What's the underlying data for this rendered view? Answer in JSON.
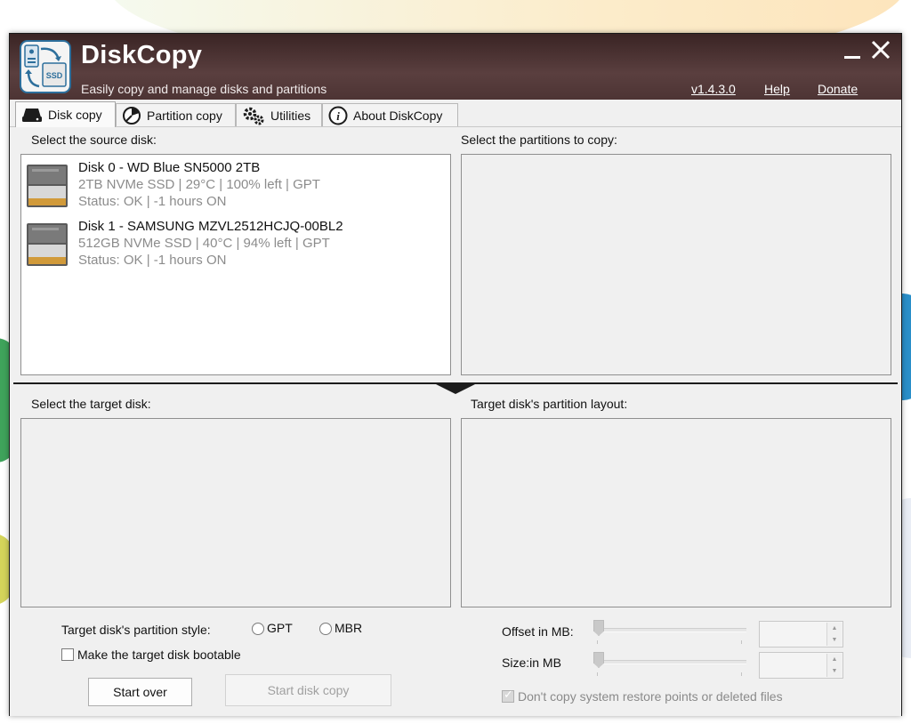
{
  "app": {
    "title": "DiskCopy",
    "subtitle": "Easily copy and manage disks and partitions",
    "version": "v1.4.3.0",
    "help": "Help",
    "donate": "Donate",
    "icon_label": "SSD"
  },
  "tabs": [
    {
      "label": "Disk copy",
      "icon": "disk-icon",
      "active": true
    },
    {
      "label": "Partition copy",
      "icon": "partition-pie-icon"
    },
    {
      "label": "Utilities",
      "icon": "gears-icon"
    },
    {
      "label": "About DiskCopy",
      "icon": "info-icon"
    }
  ],
  "source": {
    "label": "Select the source disk:",
    "disks": [
      {
        "name": "Disk 0 - WD Blue SN5000 2TB",
        "info": "2TB NVMe SSD | 29°C | 100% left | GPT",
        "status": "Status: OK | -1 hours ON"
      },
      {
        "name": "Disk 1 - SAMSUNG MZVL2512HCJQ-00BL2",
        "info": "512GB NVMe SSD | 40°C | 94% left | GPT",
        "status": "Status: OK | -1 hours ON"
      }
    ]
  },
  "partitions": {
    "label": "Select the partitions to copy:"
  },
  "target": {
    "label": "Select the target disk:"
  },
  "layout": {
    "label": "Target disk's partition layout:"
  },
  "options": {
    "style_label": "Target disk's partition style:",
    "gpt": "GPT",
    "mbr": "MBR",
    "bootable": "Make the target disk bootable",
    "start_over": "Start over",
    "start_copy": "Start disk copy",
    "offset_label": "Offset in MB:",
    "size_label": "Size:in MB",
    "no_restore": "Don't copy system restore points or deleted files"
  },
  "colors": {
    "titlebar": "#4a3232",
    "window_bg": "#f0f0f0"
  }
}
